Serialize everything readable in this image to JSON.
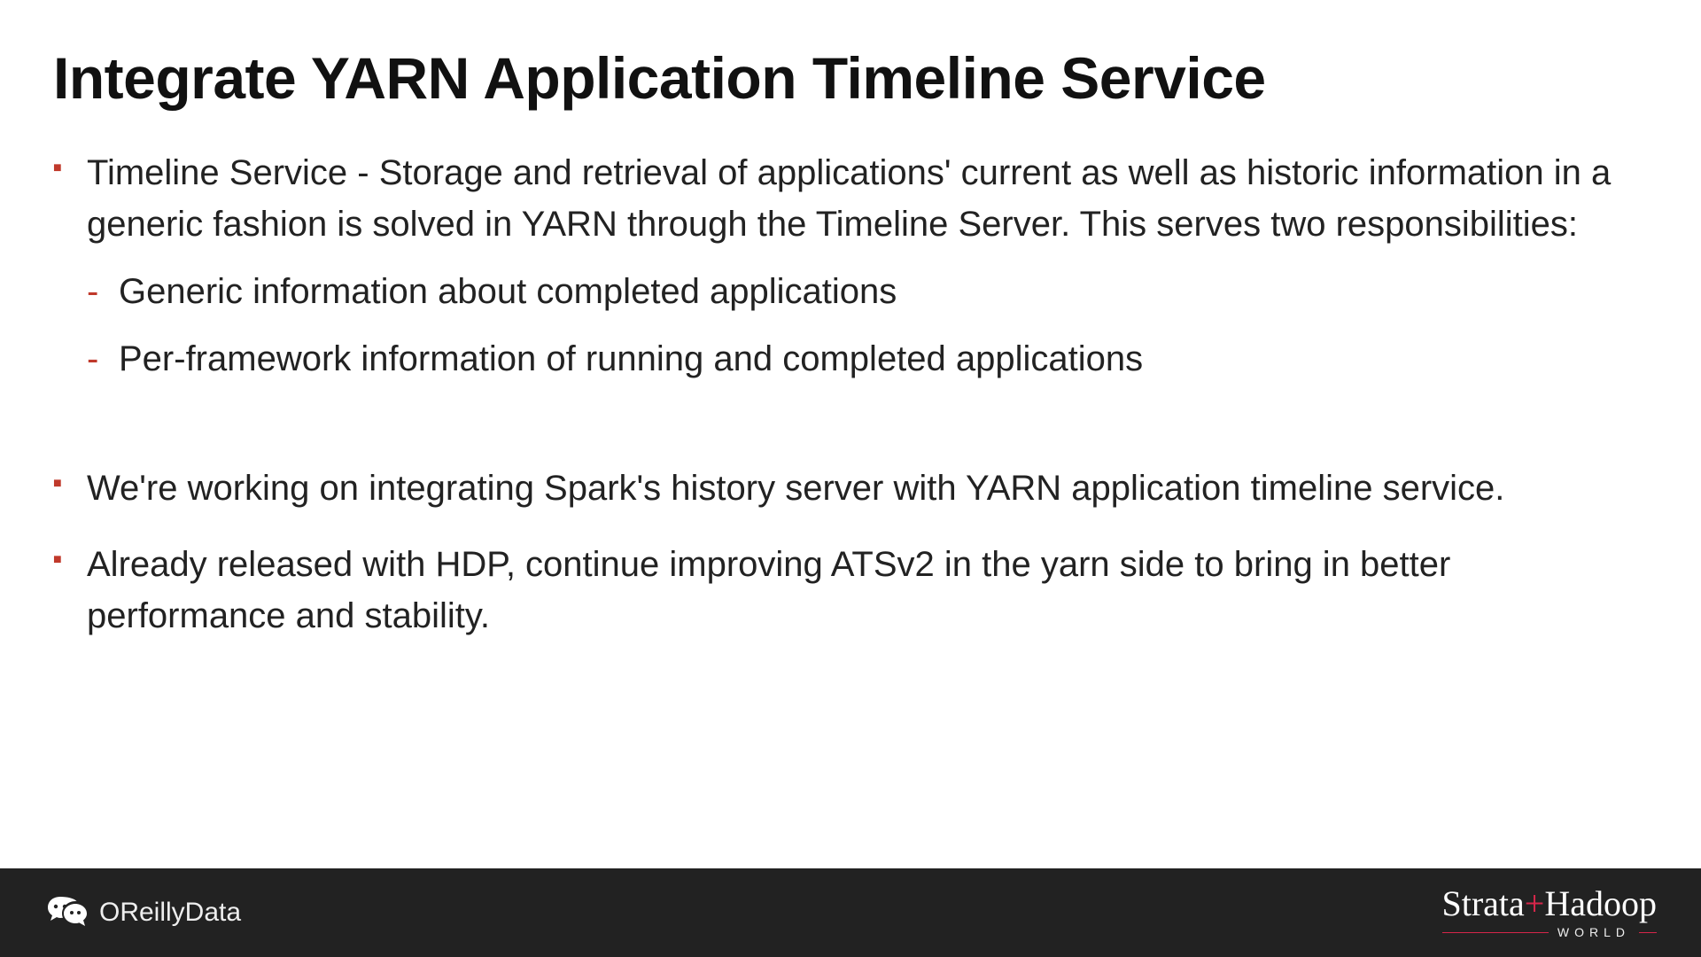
{
  "title": "Integrate YARN Application Timeline Service",
  "bullets": {
    "b1": "Timeline Service - Storage and retrieval of applications' current as well as historic information in a generic fashion is solved in YARN through the Timeline Server. This serves two responsibilities:",
    "b1_sub1": "Generic information about completed applications",
    "b1_sub2": "Per-framework information of running and completed applications",
    "b2": "We're working on integrating Spark's history server with YARN application timeline service.",
    "b3": "Already released with HDP, continue improving ATSv2 in the yarn side to bring in better performance and stability."
  },
  "footer": {
    "handle": "OReillyData",
    "brand_a": "Strata",
    "brand_plus": "+",
    "brand_b": "Hadoop",
    "brand_sub": "WORLD"
  }
}
